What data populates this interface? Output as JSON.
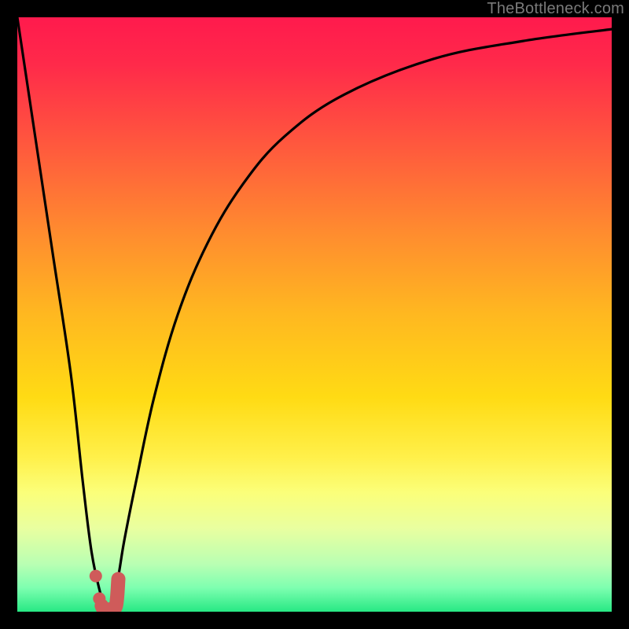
{
  "watermark": "TheBottleneck.com",
  "colors": {
    "black": "#000000",
    "curve": "#000000",
    "marker_fill": "#cf5b5a",
    "gradient_stops": [
      {
        "offset": 0,
        "color": "#ff1a4d"
      },
      {
        "offset": 0.08,
        "color": "#ff2a4a"
      },
      {
        "offset": 0.22,
        "color": "#ff5a3d"
      },
      {
        "offset": 0.36,
        "color": "#ff8b2f"
      },
      {
        "offset": 0.5,
        "color": "#ffb820"
      },
      {
        "offset": 0.64,
        "color": "#ffdb14"
      },
      {
        "offset": 0.74,
        "color": "#fff04a"
      },
      {
        "offset": 0.8,
        "color": "#fbff7a"
      },
      {
        "offset": 0.86,
        "color": "#e9ffa0"
      },
      {
        "offset": 0.92,
        "color": "#b9ffb3"
      },
      {
        "offset": 0.96,
        "color": "#7dffb0"
      },
      {
        "offset": 1.0,
        "color": "#27e884"
      }
    ]
  },
  "chart_data": {
    "type": "line",
    "title": "",
    "xlabel": "",
    "ylabel": "",
    "xlim": [
      0,
      100
    ],
    "ylim": [
      0,
      100
    ],
    "series": [
      {
        "name": "bottleneck-curve",
        "x": [
          0,
          3,
          6,
          9,
          11,
          12.5,
          14,
          15,
          16,
          17,
          18,
          20,
          23,
          27,
          32,
          38,
          45,
          55,
          70,
          85,
          100
        ],
        "y": [
          100,
          80,
          60,
          40,
          22,
          10,
          3,
          0,
          2,
          6,
          12,
          22,
          36,
          50,
          62,
          72,
          80,
          87,
          93,
          96,
          98
        ]
      }
    ],
    "markers": [
      {
        "name": "point-a",
        "x": 13.2,
        "y": 6.0
      },
      {
        "name": "point-b",
        "x": 13.8,
        "y": 2.2
      }
    ],
    "marker_path": {
      "name": "j-marker",
      "points_xy": [
        [
          14.2,
          1.0
        ],
        [
          14.6,
          0.4
        ],
        [
          15.6,
          0.4
        ],
        [
          16.6,
          1.0
        ],
        [
          17.0,
          5.5
        ]
      ]
    }
  }
}
